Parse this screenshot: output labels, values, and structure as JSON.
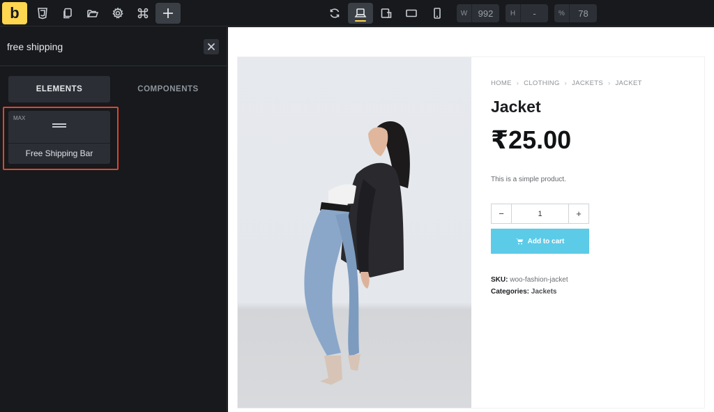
{
  "app": {
    "logo_letter": "b",
    "accent": "#ffd64f"
  },
  "toolbar": {
    "icons": [
      "css3-icon",
      "pages-icon",
      "folder-icon",
      "settings-icon",
      "command-icon",
      "add-icon",
      "refresh-icon",
      "laptop-icon",
      "tablet-landscape-icon",
      "tablet-portrait-icon",
      "mobile-icon"
    ],
    "width": {
      "label": "W",
      "value": "992"
    },
    "height": {
      "label": "H",
      "value": "-"
    },
    "zoom": {
      "label": "%",
      "value": "78"
    }
  },
  "panel": {
    "search": {
      "value": "free shipping",
      "placeholder": ""
    },
    "tabs": [
      {
        "label": "ELEMENTS",
        "active": true
      },
      {
        "label": "COMPONENTS",
        "active": false
      }
    ],
    "results": [
      {
        "badge": "MAX",
        "label": "Free Shipping Bar",
        "icon": "shipping-bar-icon"
      }
    ],
    "highlight_color": "#e0452c"
  },
  "product": {
    "breadcrumbs": [
      "HOME",
      "CLOTHING",
      "JACKETS",
      "JACKET"
    ],
    "title": "Jacket",
    "price": "₹25.00",
    "description": "This is a simple product.",
    "quantity": {
      "minus": "−",
      "value": "1",
      "plus": "+"
    },
    "add_to_cart": "Add to cart",
    "button_color": "#5ccbe8",
    "sku_label": "SKU:",
    "sku_value": "woo-fashion-jacket",
    "categories_label": "Categories:",
    "categories_value": "Jackets"
  }
}
